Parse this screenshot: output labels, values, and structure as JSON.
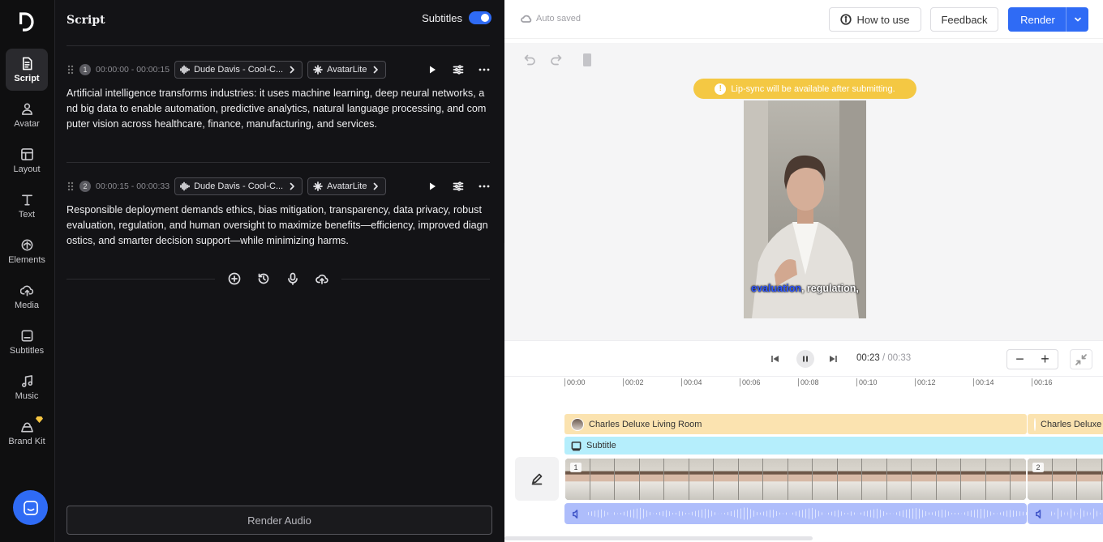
{
  "rail": {
    "items": [
      {
        "label": "Script",
        "icon": "script-icon"
      },
      {
        "label": "Avatar",
        "icon": "avatar-icon"
      },
      {
        "label": "Layout",
        "icon": "layout-icon"
      },
      {
        "label": "Text",
        "icon": "text-icon"
      },
      {
        "label": "Elements",
        "icon": "elements-icon"
      },
      {
        "label": "Media",
        "icon": "media-icon"
      },
      {
        "label": "Subtitles",
        "icon": "subtitles-icon"
      },
      {
        "label": "Music",
        "icon": "music-icon"
      },
      {
        "label": "Brand Kit",
        "icon": "brand-kit-icon"
      }
    ]
  },
  "script": {
    "title": "Script",
    "subtitles_label": "Subtitles",
    "subtitles_on": true,
    "segments": [
      {
        "num": "1",
        "time": "00:00:00 - 00:00:15",
        "voice": "Dude Davis - Cool-C...",
        "avatar": "AvatarLite",
        "text": "Artificial intelligence transforms industries: it uses machine learning, deep neural networks, and big data to enable automation, predictive analytics, natural language processing, and computer vision across healthcare, finance, manufacturing, and services."
      },
      {
        "num": "2",
        "time": "00:00:15 - 00:00:33",
        "voice": "Dude Davis - Cool-C...",
        "avatar": "AvatarLite",
        "text": "Responsible deployment demands ethics, bias mitigation, transparency, data privacy, robust evaluation, regulation, and human oversight to maximize benefits—efficiency, improved diagnostics, and smarter decision support—while minimizing harms."
      }
    ],
    "render_audio_label": "Render Audio"
  },
  "topbar": {
    "autosaved": "Auto saved",
    "how_to_use": "How to use",
    "feedback": "Feedback",
    "render": "Render"
  },
  "preview": {
    "warning": "Lip-sync will be available after submitting.",
    "caption_highlight": "evaluation",
    "caption_rest": ", regulation,"
  },
  "playback": {
    "current": "00:23",
    "separator": " / ",
    "duration": "00:33"
  },
  "timeline": {
    "ticks": [
      "00:00",
      "00:02",
      "00:04",
      "00:06",
      "00:08",
      "00:10",
      "00:12",
      "00:14",
      "00:16"
    ],
    "avatar_track_1": "Charles Deluxe Living Room",
    "avatar_track_2": "Charles Deluxe Living Room",
    "subtitle_track": "Subtitle",
    "clip_1": "1",
    "clip_2": "2"
  },
  "colors": {
    "accent": "#2f6bf5",
    "warning": "#f4c843",
    "avatar_track": "#fbe3b0",
    "subtitle_track": "#b5eefc",
    "audio_track": "#aebdfb"
  }
}
